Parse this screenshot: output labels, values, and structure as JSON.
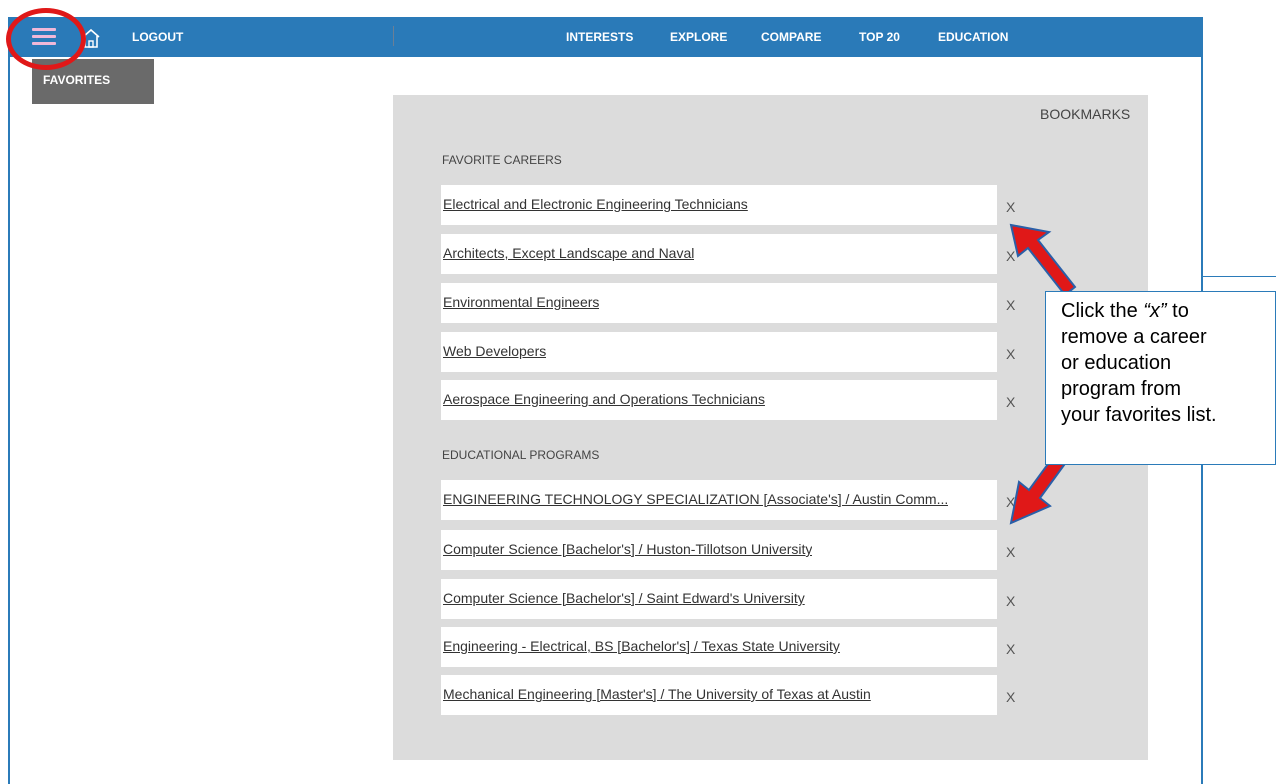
{
  "header": {
    "logout": "LOGOUT",
    "nav": [
      "INTERESTS",
      "EXPLORE",
      "COMPARE",
      "TOP 20",
      "EDUCATION"
    ],
    "favorites_tab": "FAVORITES",
    "menu_icon": "hamburger-menu-icon",
    "home_icon": "home-icon"
  },
  "panel": {
    "bookmarks": "BOOKMARKS",
    "careers_title": "FAVORITE CAREERS",
    "careers": [
      "Electrical and Electronic Engineering Technicians",
      "Architects, Except Landscape and Naval",
      "Environmental Engineers",
      "Web Developers",
      "Aerospace Engineering and Operations Technicians"
    ],
    "programs_title": "EDUCATIONAL PROGRAMS",
    "programs": [
      "ENGINEERING TECHNOLOGY SPECIALIZATION [Associate's] / Austin Comm...",
      "Computer Science [Bachelor's] / Huston-Tillotson University",
      "Computer Science [Bachelor's] / Saint Edward's University",
      "Engineering - Electrical, BS [Bachelor's] / Texas State University",
      "Mechanical Engineering [Master's] / The University of Texas at Austin"
    ],
    "remove_label": "X"
  },
  "annotation": {
    "line1_prefix": "Click the ",
    "line1_em": "“x”",
    "line1_suffix": " to",
    "line2": "remove a career",
    "line3": "or education",
    "line4": "program from",
    "line5": "your favorites list.",
    "circle_color": "#e01818",
    "arrow_color": "#e01818"
  },
  "colors": {
    "topbar": "#2a7ab8",
    "panel": "#dcdcdc",
    "tab": "#6a6a6a"
  }
}
